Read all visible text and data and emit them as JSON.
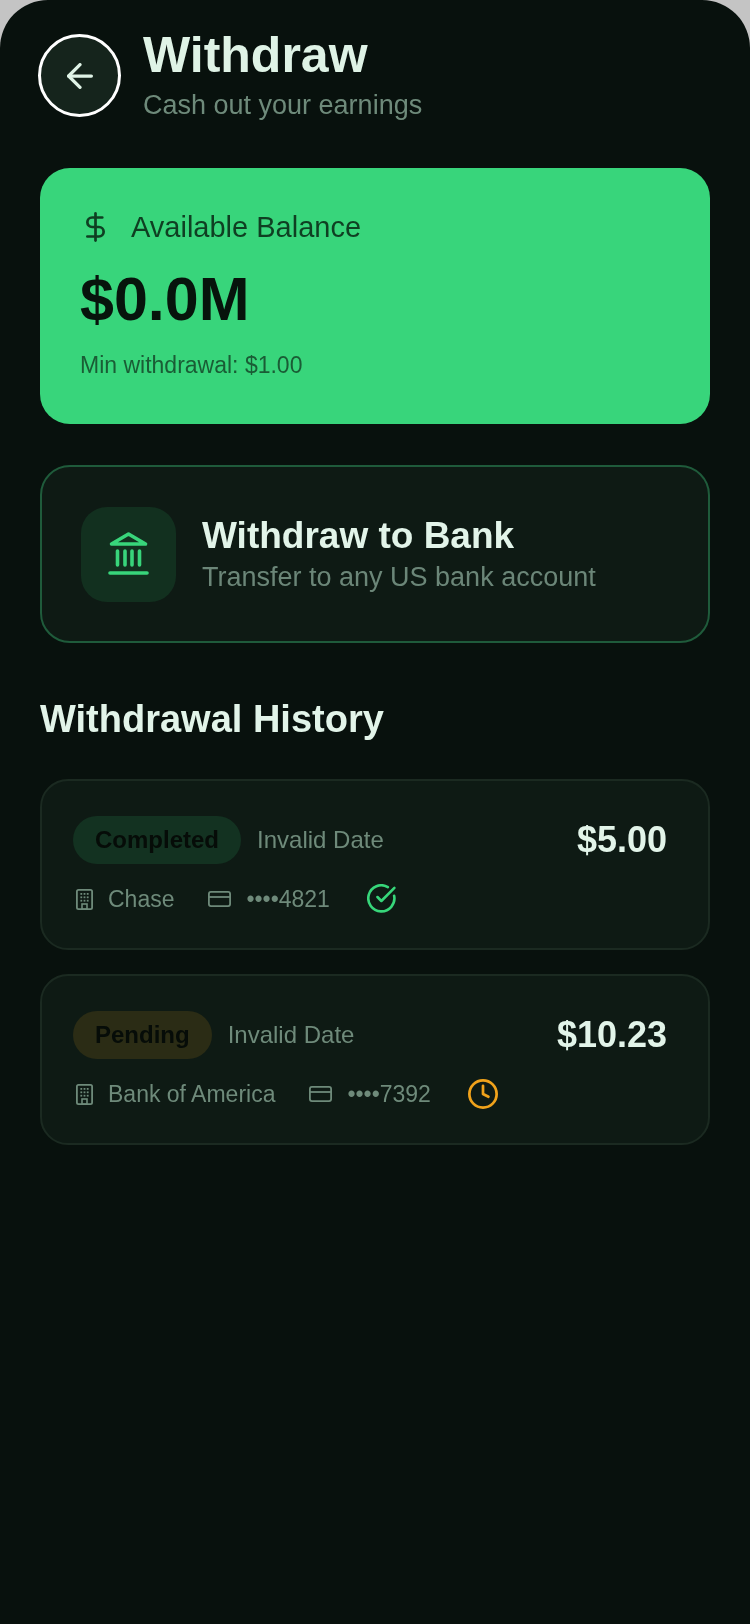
{
  "header": {
    "title": "Withdraw",
    "subtitle": "Cash out your earnings"
  },
  "balance_card": {
    "label": "Available Balance",
    "amount": "$0.0M",
    "min_withdrawal": "Min withdrawal: $1.00"
  },
  "bank_option": {
    "title": "Withdraw to Bank",
    "subtitle": "Transfer to any US bank account"
  },
  "history": {
    "title": "Withdrawal History",
    "items": [
      {
        "kind": "completed",
        "status": "Completed",
        "color": "#37d67a",
        "date": "Invalid Date",
        "amount": "$5.00",
        "bank": "Chase",
        "account": "••••4821"
      },
      {
        "kind": "pending",
        "status": "Pending",
        "color": "#f0a21b",
        "date": "Invalid Date",
        "amount": "$10.23",
        "bank": "Bank of America",
        "account": "••••7392"
      }
    ]
  }
}
